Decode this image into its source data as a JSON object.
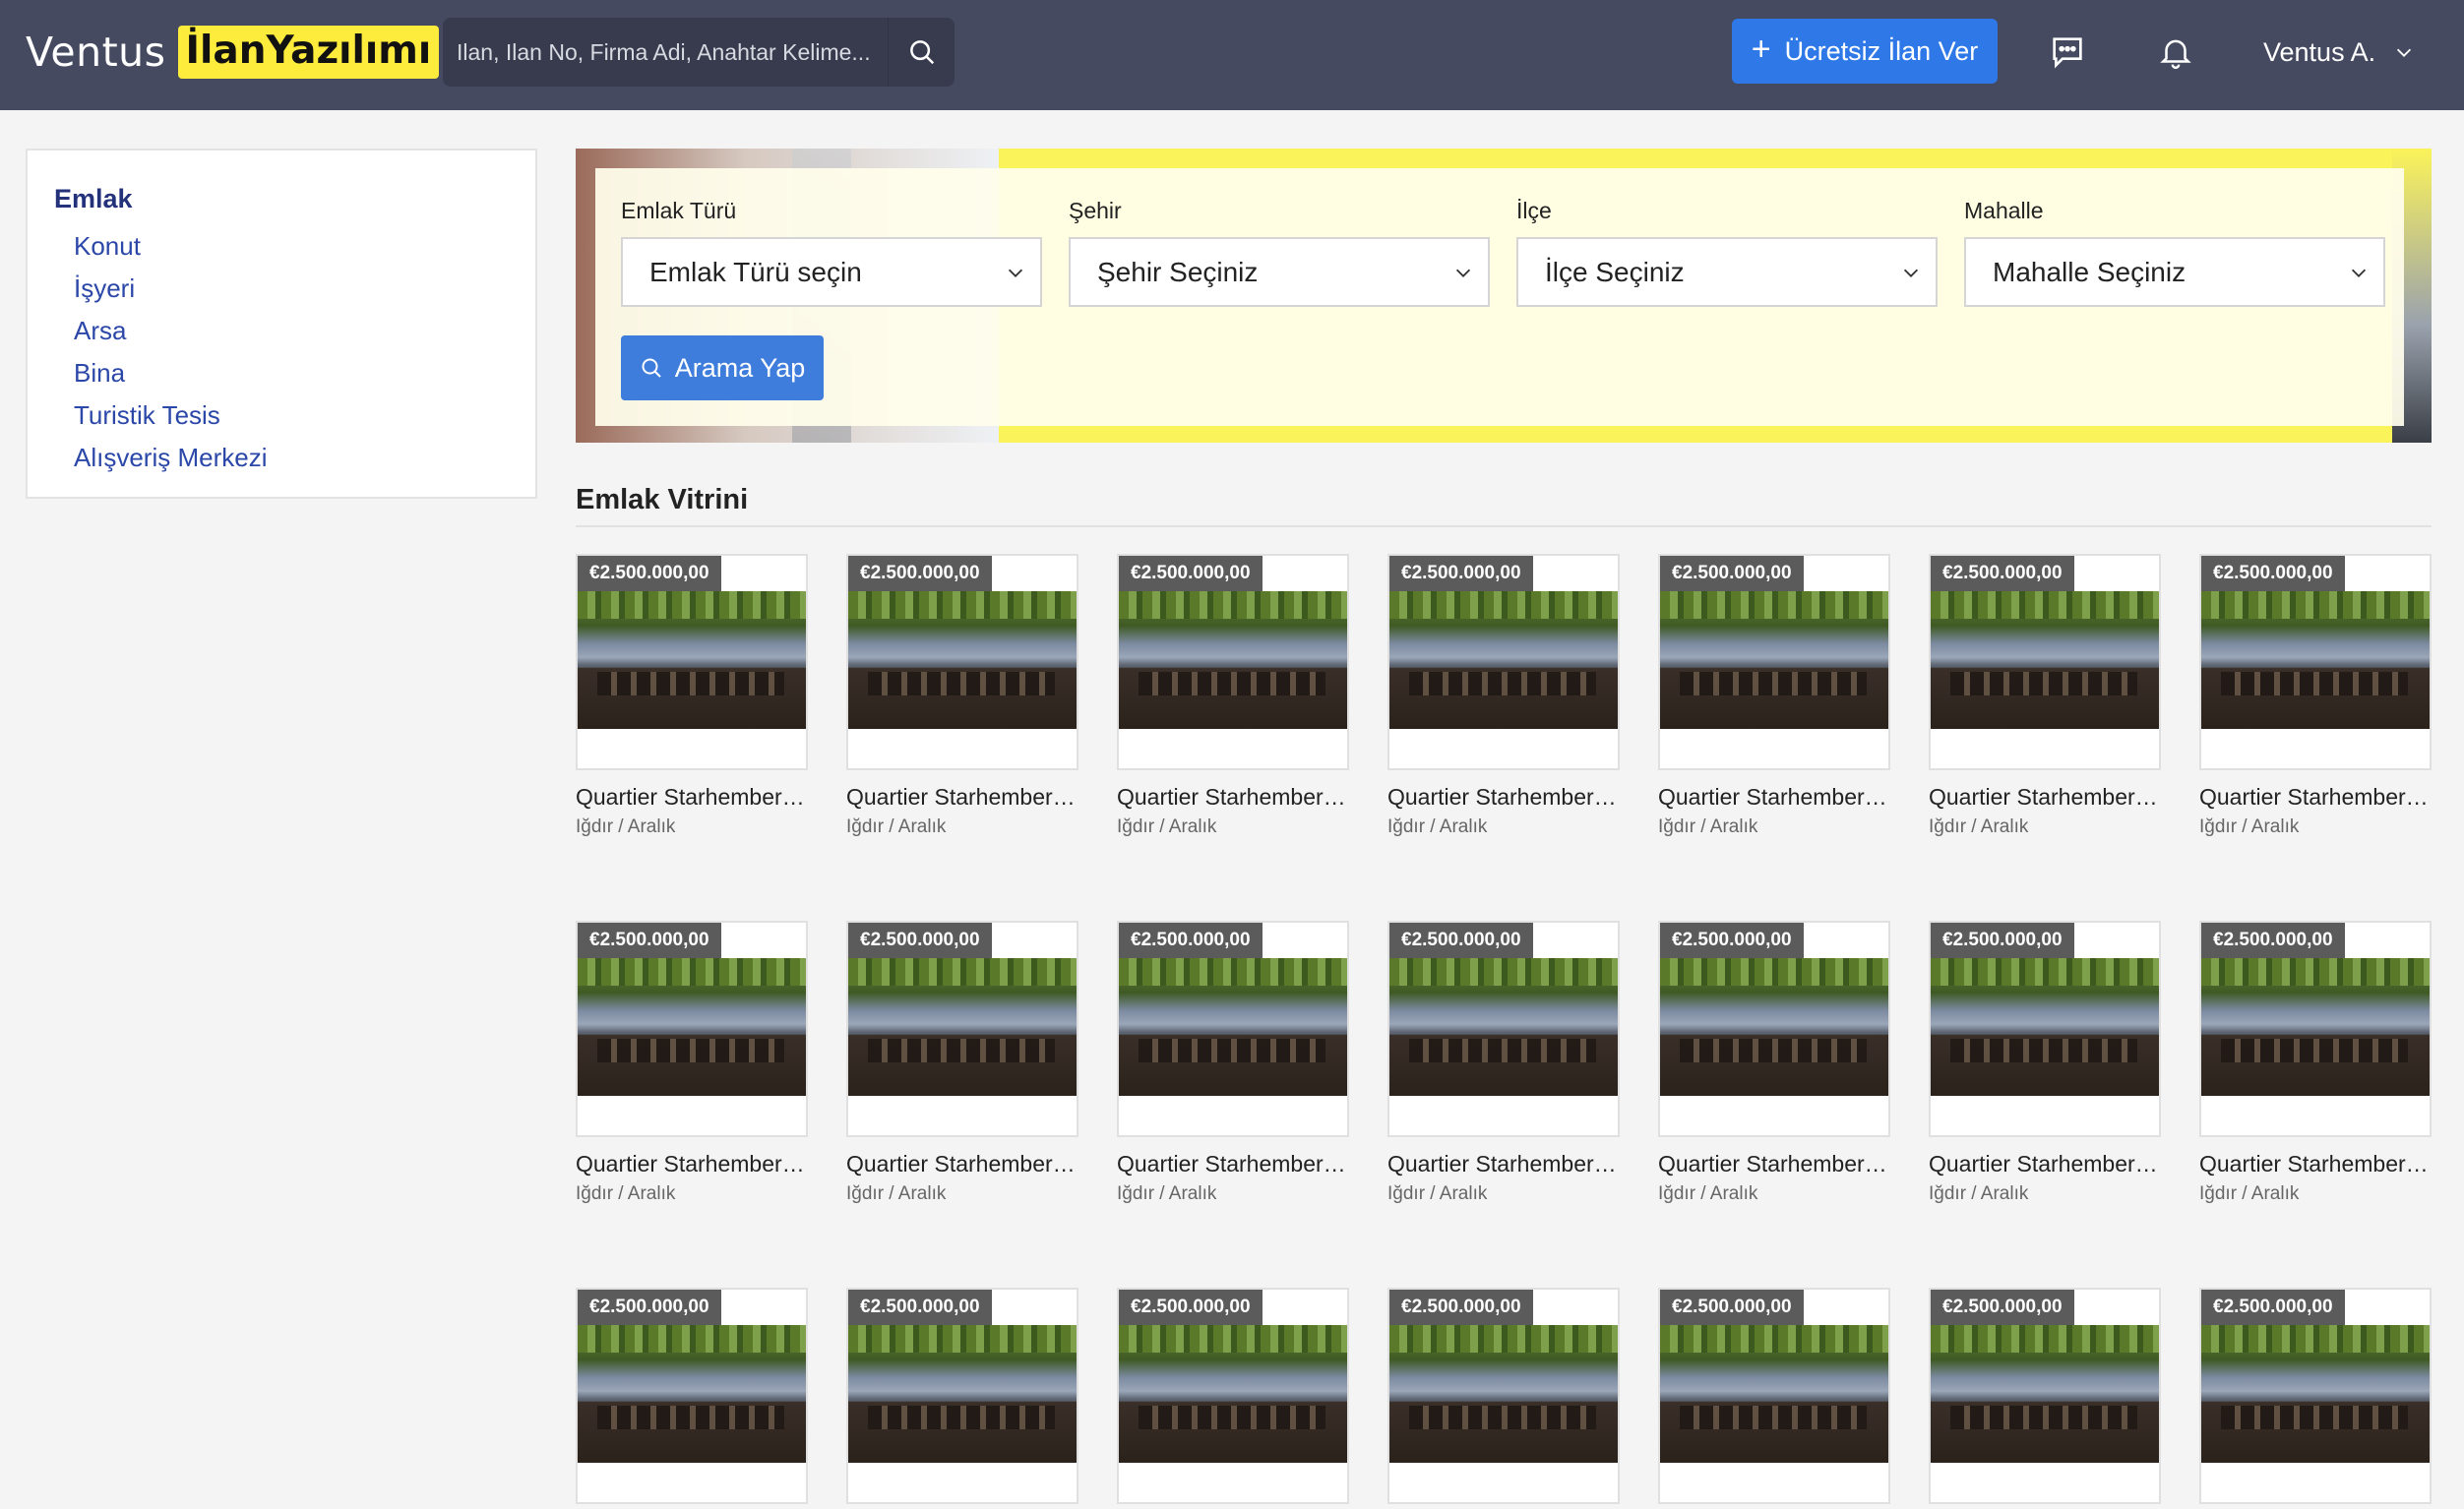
{
  "header": {
    "logo_text": "Ventus",
    "logo_badge": "İlanYazılımı",
    "search_placeholder": "Ilan, Ilan No, Firma Adi, Anahtar Kelime...",
    "post_button_label": "Ücretsiz İlan Ver",
    "user_name": "Ventus A."
  },
  "sidebar": {
    "title": "Emlak",
    "items": [
      {
        "label": "Konut"
      },
      {
        "label": "İşyeri"
      },
      {
        "label": "Arsa"
      },
      {
        "label": "Bina"
      },
      {
        "label": "Turistik Tesis"
      },
      {
        "label": "Alışveriş Merkezi"
      }
    ]
  },
  "filters": {
    "property_type": {
      "label": "Emlak Türü",
      "value": "Emlak Türü seçin"
    },
    "city": {
      "label": "Şehir",
      "value": "Şehir Seçiniz"
    },
    "district": {
      "label": "İlçe",
      "value": "İlçe Seçiniz"
    },
    "neighborhood": {
      "label": "Mahalle",
      "value": "Mahalle Seçiniz"
    },
    "search_button_label": "Arama Yap"
  },
  "showcase": {
    "title": "Emlak Vitrini",
    "listings": [
      {
        "price": "€2.500.000,00",
        "title": "Quartier Starhemberg Residences",
        "location": "Iğdır / Aralık"
      },
      {
        "price": "€2.500.000,00",
        "title": "Quartier Starhemberg Residences",
        "location": "Iğdır / Aralık"
      },
      {
        "price": "€2.500.000,00",
        "title": "Quartier Starhemberg Residences",
        "location": "Iğdır / Aralık"
      },
      {
        "price": "€2.500.000,00",
        "title": "Quartier Starhemberg Residences",
        "location": "Iğdır / Aralık"
      },
      {
        "price": "€2.500.000,00",
        "title": "Quartier Starhemberg Residences",
        "location": "Iğdır / Aralık"
      },
      {
        "price": "€2.500.000,00",
        "title": "Quartier Starhemberg Residences",
        "location": "Iğdır / Aralık"
      },
      {
        "price": "€2.500.000,00",
        "title": "Quartier Starhemberg Residences",
        "location": "Iğdır / Aralık"
      },
      {
        "price": "€2.500.000,00",
        "title": "Quartier Starhemberg Residences",
        "location": "Iğdır / Aralık"
      },
      {
        "price": "€2.500.000,00",
        "title": "Quartier Starhemberg Residences",
        "location": "Iğdır / Aralık"
      },
      {
        "price": "€2.500.000,00",
        "title": "Quartier Starhemberg Residences",
        "location": "Iğdır / Aralık"
      },
      {
        "price": "€2.500.000,00",
        "title": "Quartier Starhemberg Residences",
        "location": "Iğdır / Aralık"
      },
      {
        "price": "€2.500.000,00",
        "title": "Quartier Starhemberg Residences",
        "location": "Iğdır / Aralık"
      },
      {
        "price": "€2.500.000,00",
        "title": "Quartier Starhemberg Residences",
        "location": "Iğdır / Aralık"
      },
      {
        "price": "€2.500.000,00",
        "title": "Quartier Starhemberg Residences",
        "location": "Iğdır / Aralık"
      },
      {
        "price": "€2.500.000,00",
        "title": "Quartier Starhemberg Residences",
        "location": "Iğdır / Aralık"
      },
      {
        "price": "€2.500.000,00",
        "title": "Quartier Starhemberg Residences",
        "location": "Iğdır / Aralık"
      },
      {
        "price": "€2.500.000,00",
        "title": "Quartier Starhemberg Residences",
        "location": "Iğdır / Aralık"
      },
      {
        "price": "€2.500.000,00",
        "title": "Quartier Starhemberg Residences",
        "location": "Iğdır / Aralık"
      },
      {
        "price": "€2.500.000,00",
        "title": "Quartier Starhemberg Residences",
        "location": "Iğdır / Aralık"
      },
      {
        "price": "€2.500.000,00",
        "title": "Quartier Starhemberg Residences",
        "location": "Iğdır / Aralık"
      },
      {
        "price": "€2.500.000,00",
        "title": "Quartier Starhemberg Residences",
        "location": "Iğdır / Aralık"
      }
    ]
  },
  "icons": {
    "search": "search-icon",
    "plus": "plus-icon",
    "messages": "chat-bubble-icon",
    "notifications": "bell-icon",
    "dropdown": "chevron-down-icon"
  },
  "colors": {
    "header_bg": "#454a60",
    "brand_yellow": "#fdec3c",
    "primary_blue": "#2f78e8",
    "link_blue": "#2b47a8",
    "sidebar_title": "#23327a"
  }
}
